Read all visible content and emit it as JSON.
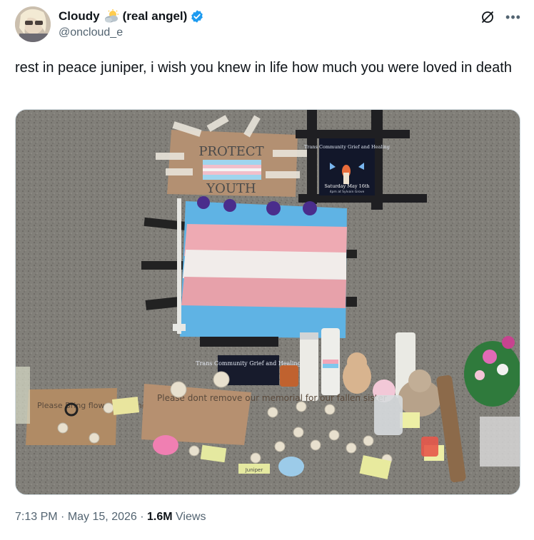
{
  "author": {
    "display_name": "Cloudy",
    "display_suffix": "(real angel)",
    "emoji": "sun-behind-cloud-icon",
    "handle": "@oncloud_e",
    "verified": true
  },
  "post": {
    "text": "rest in peace juniper, i wish you knew in life how much you were loved in death"
  },
  "media": {
    "sign_protect": "PROTECT",
    "sign_youth": "YOUTH",
    "poster_title": "Trans Community Grief and Healing",
    "poster_date": "Saturday May 16th",
    "poster_time": "4pm at Sylvain Grove",
    "small_poster_title": "Trans Community Grief and Healing",
    "note_left": "Please Bring flowers & candles",
    "note_center": "Please dont remove our memorial for our fallen sister",
    "note_juniper": "Juniper"
  },
  "meta": {
    "time": "7:13 PM",
    "separator": "·",
    "date": "May 15, 2026",
    "views_count": "1.6M",
    "views_label": "Views"
  },
  "colors": {
    "trans_blue": "#5bcefa",
    "trans_pink": "#f5a9b8",
    "white": "#ffffff",
    "verified_blue": "#1d9bf0"
  }
}
